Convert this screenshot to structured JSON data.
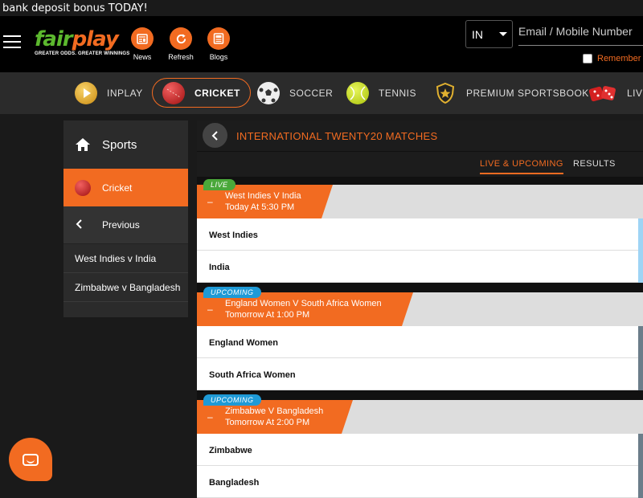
{
  "banner": {
    "text": "bank deposit bonus TODAY!"
  },
  "header": {
    "logo_fair": "fair",
    "logo_play": "play",
    "logo_tagline": "GREATER ODDS. GREATER WINNINGS",
    "icons": [
      {
        "label": "News",
        "icon": "news-icon"
      },
      {
        "label": "Refresh",
        "icon": "refresh-icon"
      },
      {
        "label": "Blogs",
        "icon": "blogs-icon"
      }
    ],
    "language": "IN",
    "email_placeholder": "Email / Mobile Number",
    "remember_label": "Remember"
  },
  "sports_nav": [
    {
      "label": "INPLAY",
      "icon": "play-icon",
      "active": false
    },
    {
      "label": "CRICKET",
      "icon": "cricket-ball-icon",
      "active": true
    },
    {
      "label": "SOCCER",
      "icon": "soccer-ball-icon",
      "active": false
    },
    {
      "label": "TENNIS",
      "icon": "tennis-ball-icon",
      "active": false
    },
    {
      "label": "PREMIUM SPORTSBOOK",
      "icon": "shield-star-icon",
      "active": false
    },
    {
      "label": "LIVE",
      "icon": "dice-icon",
      "active": false
    }
  ],
  "sidebar": {
    "sports_label": "Sports",
    "cricket_label": "Cricket",
    "previous_label": "Previous",
    "matches": [
      "West Indies v India",
      "Zimbabwe v Bangladesh"
    ]
  },
  "main": {
    "title": "INTERNATIONAL TWENTY20 MATCHES",
    "tabs": {
      "live_upcoming": "LIVE & UPCOMING",
      "results": "RESULTS"
    },
    "events": [
      {
        "status": "LIVE",
        "name": "West Indies V India",
        "time": "Today At 5:30 PM",
        "teams": [
          "West Indies",
          "India"
        ]
      },
      {
        "status": "UPCOMING",
        "name": "England Women V South Africa Women",
        "time": "Tomorrow At 1:00 PM",
        "teams": [
          "England Women",
          "South Africa Women"
        ]
      },
      {
        "status": "UPCOMING",
        "name": "Zimbabwe V Bangladesh",
        "time": "Tomorrow At 2:00 PM",
        "teams": [
          "Zimbabwe",
          "Bangladesh"
        ]
      }
    ]
  },
  "colors": {
    "accent": "#f26b21",
    "brand_green": "#5cb82e",
    "live_badge": "#4aa83a",
    "upcoming_badge": "#1e9ad6"
  }
}
